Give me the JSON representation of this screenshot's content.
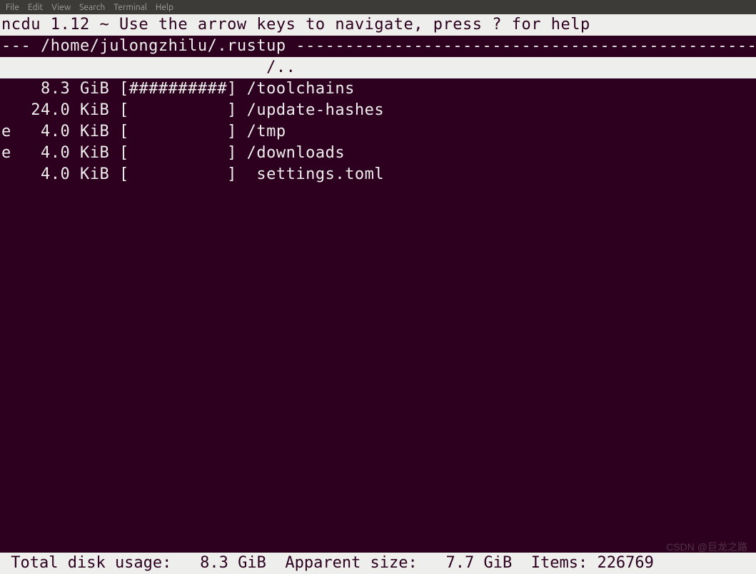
{
  "menubar": {
    "items": [
      "File",
      "Edit",
      "View",
      "Search",
      "Terminal",
      "Help"
    ]
  },
  "header": {
    "text": "ncdu 1.12 ~ Use the arrow keys to navigate, press ? for help"
  },
  "path": {
    "prefix": "--- ",
    "value": "/home/julongzhilu/.rustup",
    "suffix": " -------------------------------------------------"
  },
  "selected": {
    "text": "                           /.."
  },
  "entries": [
    {
      "flag": " ",
      "size": "   8.3 GiB",
      "bar": "[##########]",
      "name": " /toolchains"
    },
    {
      "flag": " ",
      "size": "  24.0 KiB",
      "bar": "[          ]",
      "name": " /update-hashes"
    },
    {
      "flag": "e",
      "size": "   4.0 KiB",
      "bar": "[          ]",
      "name": " /tmp"
    },
    {
      "flag": "e",
      "size": "   4.0 KiB",
      "bar": "[          ]",
      "name": " /downloads"
    },
    {
      "flag": " ",
      "size": "   4.0 KiB",
      "bar": "[          ]",
      "name": "  settings.toml"
    }
  ],
  "footer": {
    "text": " Total disk usage:   8.3 GiB  Apparent size:   7.7 GiB  Items: 226769"
  },
  "watermark": "CSDN @巨龙之路"
}
